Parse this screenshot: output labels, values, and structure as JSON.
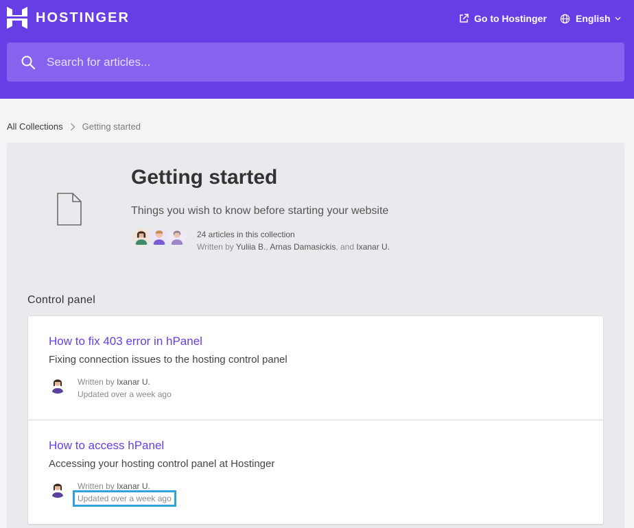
{
  "header": {
    "brand": "HOSTINGER",
    "go_link": "Go to Hostinger",
    "language": "English",
    "colors": {
      "brand_purple": "#673de6",
      "search_bg": "#8563ee"
    }
  },
  "search": {
    "placeholder": "Search for articles..."
  },
  "breadcrumb": {
    "root": "All Collections",
    "current": "Getting started"
  },
  "collection": {
    "title": "Getting started",
    "description": "Things you wish to know before starting your website",
    "article_count": "24 articles in this collection",
    "written_by_prefix": "Written by",
    "authors": [
      "Yuliia B.",
      "Arnas Damasickis",
      "Ixanar U."
    ],
    "sep_comma": ",",
    "sep_and": ", and"
  },
  "section": {
    "title": "Control panel"
  },
  "articles": [
    {
      "title": "How to fix 403 error in hPanel",
      "description": "Fixing connection issues to the hosting control panel",
      "written_prefix": "Written by",
      "author": "Ixanar U.",
      "updated": "Updated over a week ago"
    },
    {
      "title": "How to access hPanel",
      "description": "Accessing your hosting control panel at Hostinger",
      "written_prefix": "Written by",
      "author": "Ixanar U.",
      "updated": "Updated over a week ago"
    }
  ],
  "icons": [
    "hostinger-logo-icon",
    "external-link-icon",
    "globe-icon",
    "chevron-down-icon",
    "search-icon",
    "chevron-right-icon",
    "document-icon"
  ]
}
